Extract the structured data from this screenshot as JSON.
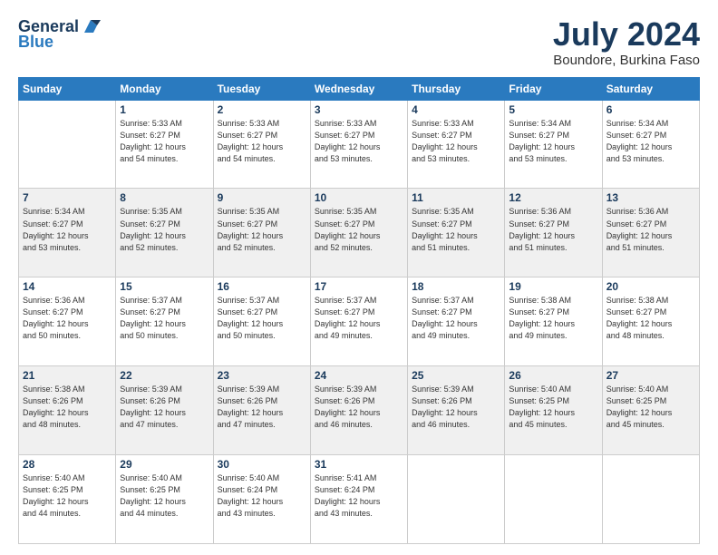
{
  "header": {
    "logo_line1": "General",
    "logo_line2": "Blue",
    "month": "July 2024",
    "location": "Boundore, Burkina Faso"
  },
  "days_of_week": [
    "Sunday",
    "Monday",
    "Tuesday",
    "Wednesday",
    "Thursday",
    "Friday",
    "Saturday"
  ],
  "weeks": [
    [
      {
        "day": "",
        "info": ""
      },
      {
        "day": "1",
        "info": "Sunrise: 5:33 AM\nSunset: 6:27 PM\nDaylight: 12 hours\nand 54 minutes."
      },
      {
        "day": "2",
        "info": "Sunrise: 5:33 AM\nSunset: 6:27 PM\nDaylight: 12 hours\nand 54 minutes."
      },
      {
        "day": "3",
        "info": "Sunrise: 5:33 AM\nSunset: 6:27 PM\nDaylight: 12 hours\nand 53 minutes."
      },
      {
        "day": "4",
        "info": "Sunrise: 5:33 AM\nSunset: 6:27 PM\nDaylight: 12 hours\nand 53 minutes."
      },
      {
        "day": "5",
        "info": "Sunrise: 5:34 AM\nSunset: 6:27 PM\nDaylight: 12 hours\nand 53 minutes."
      },
      {
        "day": "6",
        "info": "Sunrise: 5:34 AM\nSunset: 6:27 PM\nDaylight: 12 hours\nand 53 minutes."
      }
    ],
    [
      {
        "day": "7",
        "info": "Sunrise: 5:34 AM\nSunset: 6:27 PM\nDaylight: 12 hours\nand 53 minutes."
      },
      {
        "day": "8",
        "info": "Sunrise: 5:35 AM\nSunset: 6:27 PM\nDaylight: 12 hours\nand 52 minutes."
      },
      {
        "day": "9",
        "info": "Sunrise: 5:35 AM\nSunset: 6:27 PM\nDaylight: 12 hours\nand 52 minutes."
      },
      {
        "day": "10",
        "info": "Sunrise: 5:35 AM\nSunset: 6:27 PM\nDaylight: 12 hours\nand 52 minutes."
      },
      {
        "day": "11",
        "info": "Sunrise: 5:35 AM\nSunset: 6:27 PM\nDaylight: 12 hours\nand 51 minutes."
      },
      {
        "day": "12",
        "info": "Sunrise: 5:36 AM\nSunset: 6:27 PM\nDaylight: 12 hours\nand 51 minutes."
      },
      {
        "day": "13",
        "info": "Sunrise: 5:36 AM\nSunset: 6:27 PM\nDaylight: 12 hours\nand 51 minutes."
      }
    ],
    [
      {
        "day": "14",
        "info": "Sunrise: 5:36 AM\nSunset: 6:27 PM\nDaylight: 12 hours\nand 50 minutes."
      },
      {
        "day": "15",
        "info": "Sunrise: 5:37 AM\nSunset: 6:27 PM\nDaylight: 12 hours\nand 50 minutes."
      },
      {
        "day": "16",
        "info": "Sunrise: 5:37 AM\nSunset: 6:27 PM\nDaylight: 12 hours\nand 50 minutes."
      },
      {
        "day": "17",
        "info": "Sunrise: 5:37 AM\nSunset: 6:27 PM\nDaylight: 12 hours\nand 49 minutes."
      },
      {
        "day": "18",
        "info": "Sunrise: 5:37 AM\nSunset: 6:27 PM\nDaylight: 12 hours\nand 49 minutes."
      },
      {
        "day": "19",
        "info": "Sunrise: 5:38 AM\nSunset: 6:27 PM\nDaylight: 12 hours\nand 49 minutes."
      },
      {
        "day": "20",
        "info": "Sunrise: 5:38 AM\nSunset: 6:27 PM\nDaylight: 12 hours\nand 48 minutes."
      }
    ],
    [
      {
        "day": "21",
        "info": "Sunrise: 5:38 AM\nSunset: 6:26 PM\nDaylight: 12 hours\nand 48 minutes."
      },
      {
        "day": "22",
        "info": "Sunrise: 5:39 AM\nSunset: 6:26 PM\nDaylight: 12 hours\nand 47 minutes."
      },
      {
        "day": "23",
        "info": "Sunrise: 5:39 AM\nSunset: 6:26 PM\nDaylight: 12 hours\nand 47 minutes."
      },
      {
        "day": "24",
        "info": "Sunrise: 5:39 AM\nSunset: 6:26 PM\nDaylight: 12 hours\nand 46 minutes."
      },
      {
        "day": "25",
        "info": "Sunrise: 5:39 AM\nSunset: 6:26 PM\nDaylight: 12 hours\nand 46 minutes."
      },
      {
        "day": "26",
        "info": "Sunrise: 5:40 AM\nSunset: 6:25 PM\nDaylight: 12 hours\nand 45 minutes."
      },
      {
        "day": "27",
        "info": "Sunrise: 5:40 AM\nSunset: 6:25 PM\nDaylight: 12 hours\nand 45 minutes."
      }
    ],
    [
      {
        "day": "28",
        "info": "Sunrise: 5:40 AM\nSunset: 6:25 PM\nDaylight: 12 hours\nand 44 minutes."
      },
      {
        "day": "29",
        "info": "Sunrise: 5:40 AM\nSunset: 6:25 PM\nDaylight: 12 hours\nand 44 minutes."
      },
      {
        "day": "30",
        "info": "Sunrise: 5:40 AM\nSunset: 6:24 PM\nDaylight: 12 hours\nand 43 minutes."
      },
      {
        "day": "31",
        "info": "Sunrise: 5:41 AM\nSunset: 6:24 PM\nDaylight: 12 hours\nand 43 minutes."
      },
      {
        "day": "",
        "info": ""
      },
      {
        "day": "",
        "info": ""
      },
      {
        "day": "",
        "info": ""
      }
    ]
  ]
}
